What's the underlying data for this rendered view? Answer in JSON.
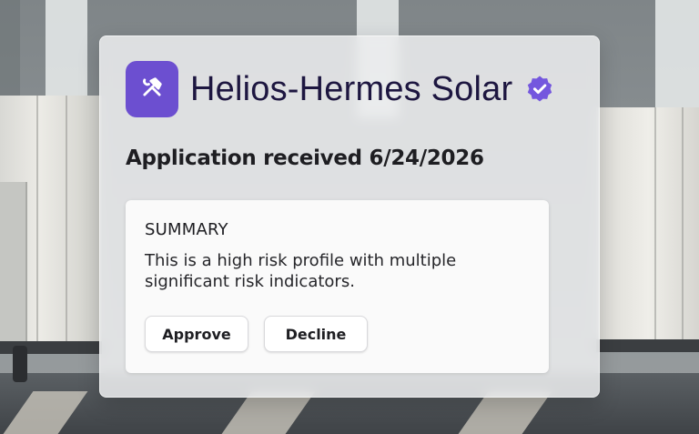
{
  "company": {
    "name": "Helios-Hermes Solar",
    "logo_icon": "hammer-wrench-icon",
    "verified_icon": "verified-badge-icon",
    "brand_color": "#6c4fd0"
  },
  "application": {
    "status_text": "Application received 6/24/2026"
  },
  "summary": {
    "title": "SUMMARY",
    "text": "This is a high risk profile with multiple significant risk indicators."
  },
  "actions": {
    "approve_label": "Approve",
    "decline_label": "Decline"
  }
}
